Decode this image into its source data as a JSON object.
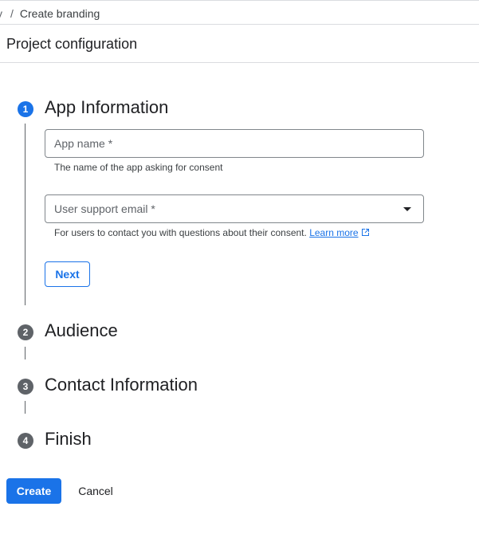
{
  "breadcrumb": {
    "prev_partial": "y",
    "separator": "/",
    "current": "Create branding"
  },
  "header": {
    "title": "Project configuration"
  },
  "steps": [
    {
      "number": "1",
      "title": "App Information",
      "state": "active"
    },
    {
      "number": "2",
      "title": "Audience",
      "state": "inactive"
    },
    {
      "number": "3",
      "title": "Contact Information",
      "state": "inactive"
    },
    {
      "number": "4",
      "title": "Finish",
      "state": "inactive"
    }
  ],
  "app_name": {
    "placeholder": "App name *",
    "value": "",
    "hint": "The name of the app asking for consent"
  },
  "support_email": {
    "placeholder": "User support email *",
    "value": "",
    "hint": "For users to contact you with questions about their consent.",
    "link_text": "Learn more",
    "dropdown_icon": "arrow-drop-down-icon"
  },
  "buttons": {
    "next": "Next",
    "create": "Create",
    "cancel": "Cancel"
  },
  "colors": {
    "primary": "#1a73e8",
    "inactive_step": "#5f6368",
    "text": "#202124"
  }
}
